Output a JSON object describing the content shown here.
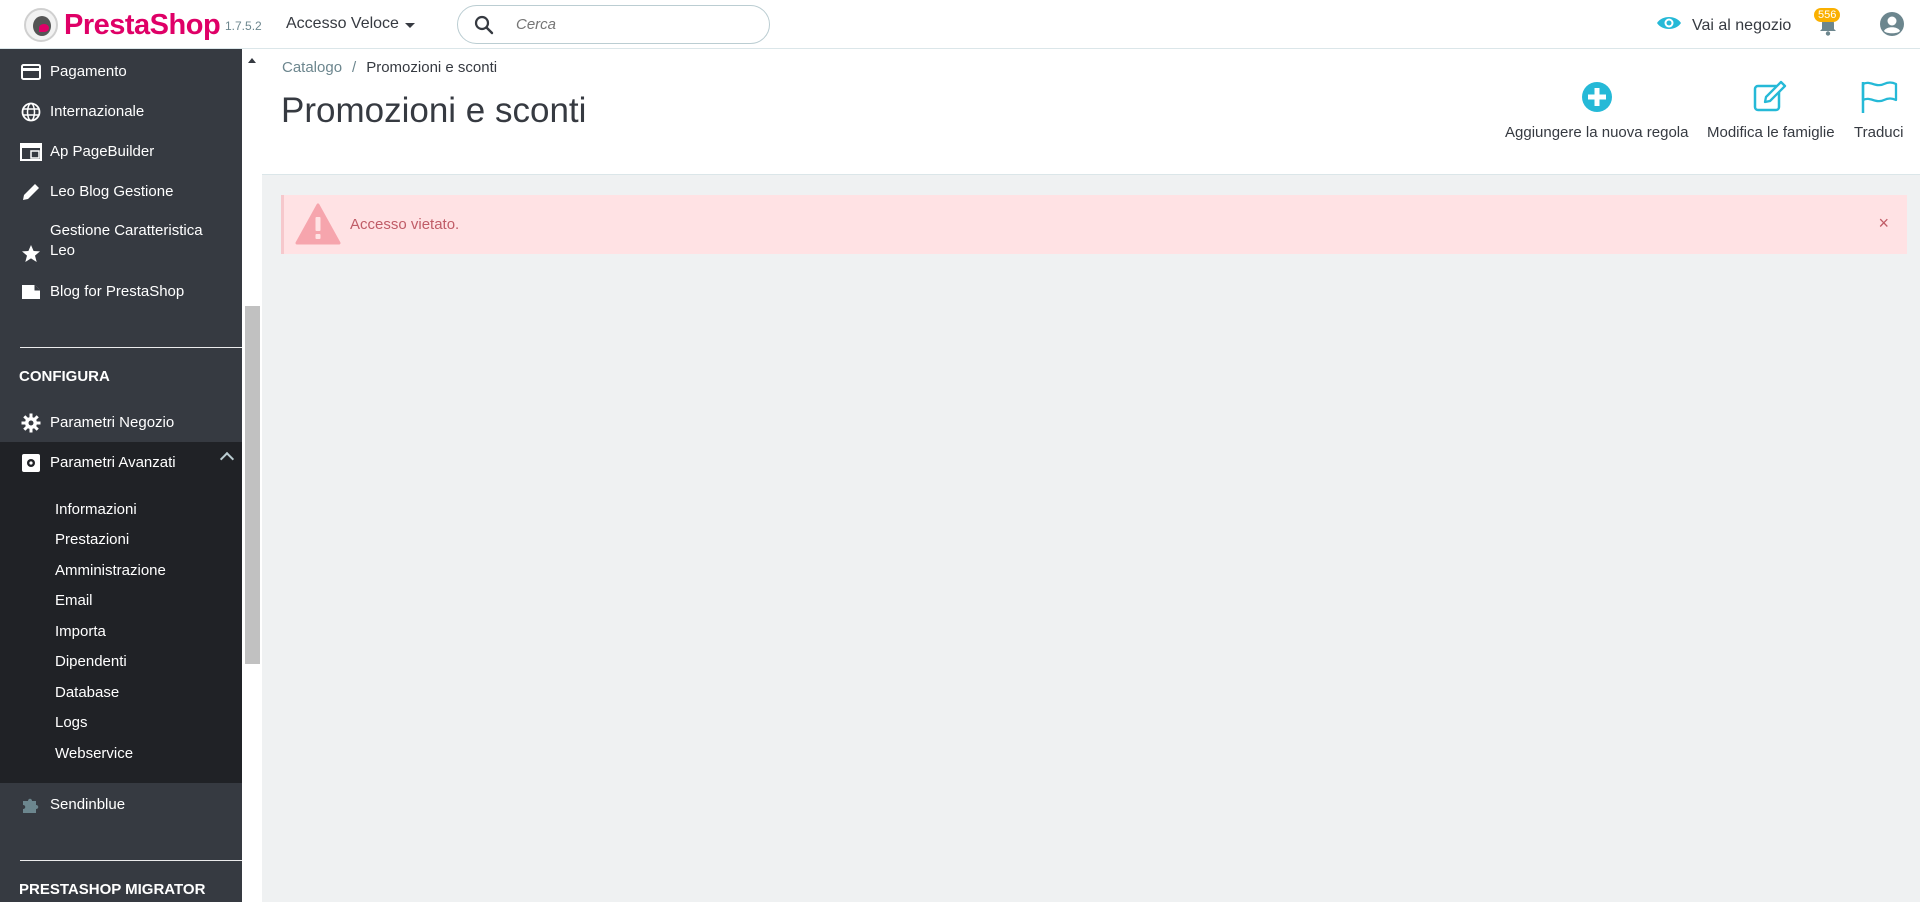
{
  "header": {
    "brand": "PrestaShop",
    "version": "1.7.5.2",
    "quick_access": "Accesso Veloce",
    "search_placeholder": "Cerca",
    "view_shop": "Vai al negozio",
    "notifications_count": "556"
  },
  "sidebar": {
    "items_top": [
      {
        "label": "Pagamento",
        "icon": "credit-card-icon"
      },
      {
        "label": "Internazionale",
        "icon": "globe-icon"
      },
      {
        "label": "Ap PageBuilder",
        "icon": "window-icon"
      },
      {
        "label": "Leo Blog Gestione",
        "icon": "pencil-icon"
      },
      {
        "label": "Gestione Caratteristica Leo",
        "icon": "star-icon"
      },
      {
        "label": "Blog for PrestaShop",
        "icon": "folder-icon"
      }
    ],
    "section_configura": "CONFIGURA",
    "parametri_negozio": "Parametri Negozio",
    "parametri_avanzati": "Parametri Avanzati",
    "sub_items": [
      "Informazioni",
      "Prestazioni",
      "Amministrazione",
      "Email",
      "Importa",
      "Dipendenti",
      "Database",
      "Logs",
      "Webservice"
    ],
    "sendinblue": "Sendinblue",
    "section_migrator": "PRESTASHOP MIGRATOR"
  },
  "page": {
    "breadcrumb_parent": "Catalogo",
    "breadcrumb_separator": "/",
    "breadcrumb_current": "Promozioni e sconti",
    "title": "Promozioni e sconti",
    "toolbar": {
      "add_rule": "Aggiungere la nuova regola",
      "edit_families": "Modifica le famiglie",
      "translate": "Traduci"
    }
  },
  "alert": {
    "message": "Accesso vietato.",
    "close": "×"
  },
  "colors": {
    "brand": "#df0067",
    "accent": "#25b9d7",
    "sidebar": "#363a41",
    "sidebar_active": "#202226",
    "alert_bg": "#ffe2e4",
    "alert_text": "#c05c67",
    "badge": "#fab000"
  }
}
